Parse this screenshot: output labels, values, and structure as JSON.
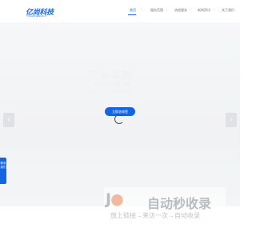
{
  "header": {
    "logo_main": "亿尚科技",
    "logo_sub": "YICHUNENGKJI"
  },
  "nav": {
    "items": [
      "首页",
      "服务范围",
      "流程服务",
      "新闻资讯",
      "关于我们"
    ]
  },
  "hero": {
    "title": "亿尚卓越",
    "subtitle": "专注·高效·创新·共赢",
    "subtitle2": "以客户为中心 提供优质的服务",
    "cta_label": "立即咨询签"
  },
  "arrows": {
    "left": "‹",
    "right": "›"
  },
  "side_tab": {
    "label": "联系我们"
  },
  "watermark": {
    "title": "自动秒收录",
    "subtitle": "放上链接→来访一次→自动收录"
  },
  "colors": {
    "accent": "#1565e0",
    "nav_active": "#1a66e8"
  }
}
